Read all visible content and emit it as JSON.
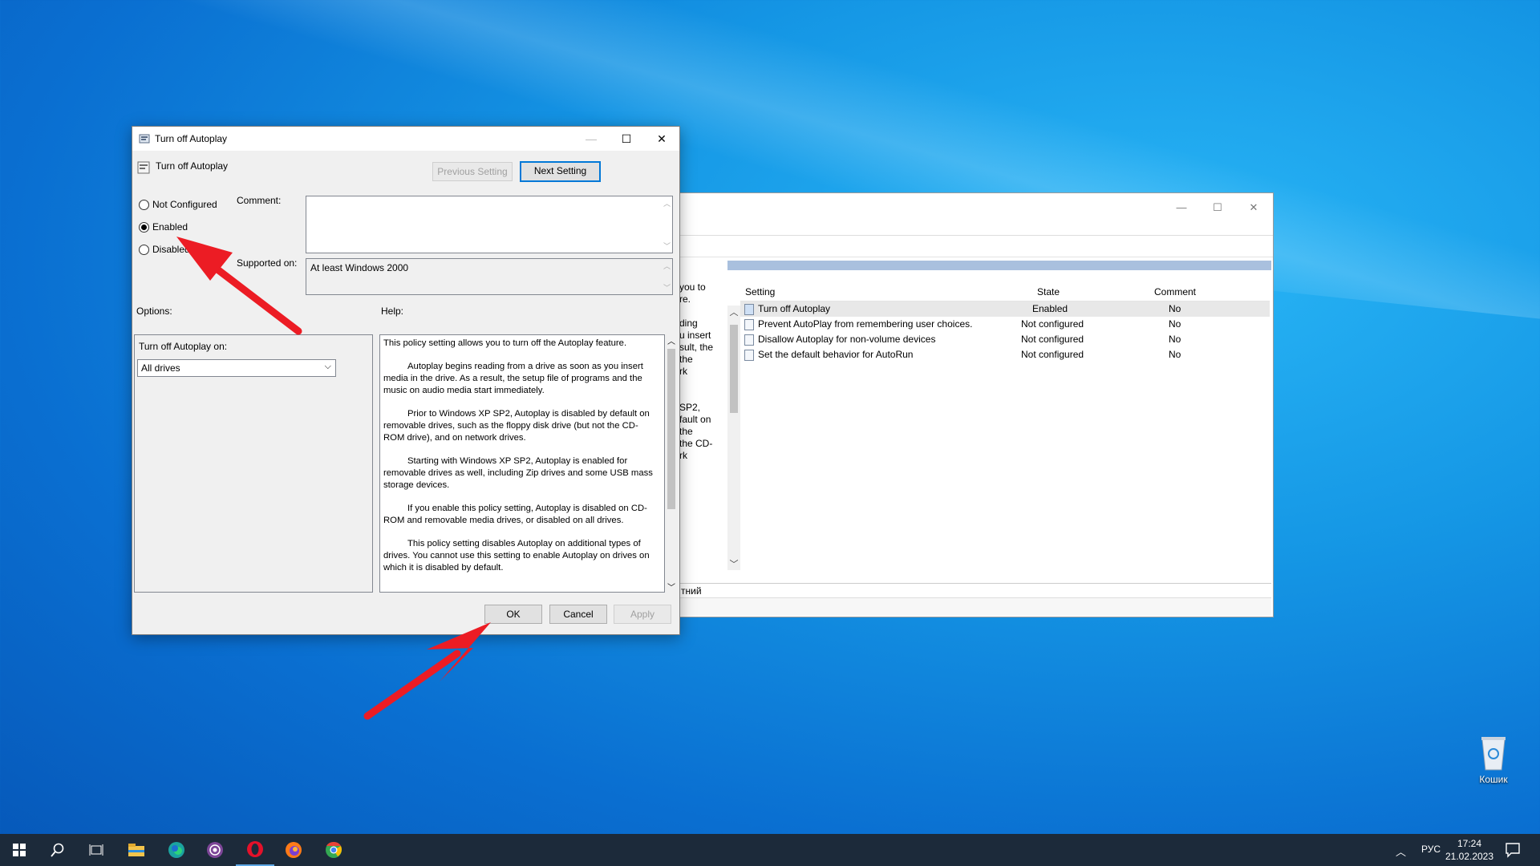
{
  "background_window": {
    "left_pane_fragments": [
      "you to",
      "re.",
      "",
      "ding",
      "u insert",
      "sult, the",
      "the",
      "rk",
      "",
      "SP2,",
      "fault on",
      "the",
      "the CD-",
      "rk"
    ],
    "columns": {
      "setting": "Setting",
      "state": "State",
      "comment": "Comment"
    },
    "rows": [
      {
        "setting": "Turn off Autoplay",
        "state": "Enabled",
        "comment": "No"
      },
      {
        "setting": "Prevent AutoPlay from remembering user choices.",
        "state": "Not configured",
        "comment": "No"
      },
      {
        "setting": "Disallow Autoplay for non-volume devices",
        "state": "Not configured",
        "comment": "No"
      },
      {
        "setting": "Set the default behavior for AutoRun",
        "state": "Not configured",
        "comment": "No"
      }
    ],
    "bottom_tab": "тний"
  },
  "dialog": {
    "title": "Turn off Autoplay",
    "setting_name": "Turn off Autoplay",
    "prev_button": "Previous Setting",
    "next_button": "Next Setting",
    "radio_not_configured": "Not Configured",
    "radio_enabled": "Enabled",
    "radio_disabled": "Disabled",
    "selected_option": "Enabled",
    "comment_label": "Comment:",
    "comment_value": "",
    "supported_label": "Supported on:",
    "supported_value": "At least Windows 2000",
    "options_label": "Options:",
    "help_label": "Help:",
    "autoplay_on_label": "Turn off Autoplay on:",
    "autoplay_on_value": "All drives",
    "help_paragraphs": [
      "This policy setting allows you to turn off the Autoplay feature.",
      "Autoplay begins reading from a drive as soon as you insert media in the drive. As a result, the setup file of programs and the music on audio media start immediately.",
      "Prior to Windows XP SP2, Autoplay is disabled by default on removable drives, such as the floppy disk drive (but not the CD-ROM drive), and on network drives.",
      "Starting with Windows XP SP2, Autoplay is enabled for removable drives as well, including Zip drives and some USB mass storage devices.",
      "If you enable this policy setting, Autoplay is disabled on CD-ROM and removable media drives, or disabled on all drives.",
      "This policy setting disables Autoplay on additional types of drives. You cannot use this setting to enable Autoplay on drives on which it is disabled by default."
    ],
    "ok": "OK",
    "cancel": "Cancel",
    "apply": "Apply"
  },
  "desktop": {
    "recycle_bin": "Кошик"
  },
  "taskbar": {
    "language": "РУС",
    "time": "17:24",
    "date": "21.02.2023"
  },
  "colors": {
    "accent": "#0078d7",
    "arrow": "#ec1c24",
    "taskbar": "#1c2a3a"
  }
}
